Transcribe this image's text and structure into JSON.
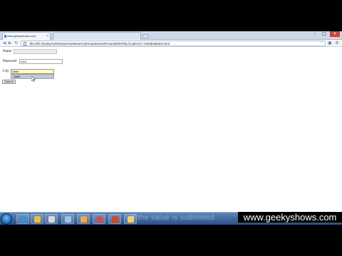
{
  "browser": {
    "tabs": [
      {
        "label": "www.geekyshows.com"
      },
      {
        "label": ""
      }
    ],
    "address": "file:///E:/Geeky%20Shows%20New%20Youtube%20Tutorials/HTML/Code/117.%20disabled.html",
    "nav": {
      "back": "◀",
      "forward": "▶",
      "reload": "↻"
    },
    "window_controls": {
      "minimize": "–",
      "maximize": "□",
      "close": "✕"
    }
  },
  "form": {
    "name_label": "Name",
    "name_value": "",
    "password_label": "Password",
    "password_value": "••••••",
    "city_label": "City",
    "city_value": "Delhi",
    "autocomplete_option": "Delhi",
    "submit_label": "Submit"
  },
  "taskbar": {
    "caption": "if the value is submitted",
    "icons": [
      "windows-start",
      "explorer",
      "ie",
      "media",
      "notepad",
      "paint",
      "vlc",
      "chrome",
      "powerpoint"
    ]
  },
  "watermark": "www.geekyshows.com",
  "colors": {
    "letterbox": "#000000",
    "taskbar": "#3b6aa0",
    "city_highlight": "#fbfbc4",
    "close_button": "#c9463d"
  }
}
